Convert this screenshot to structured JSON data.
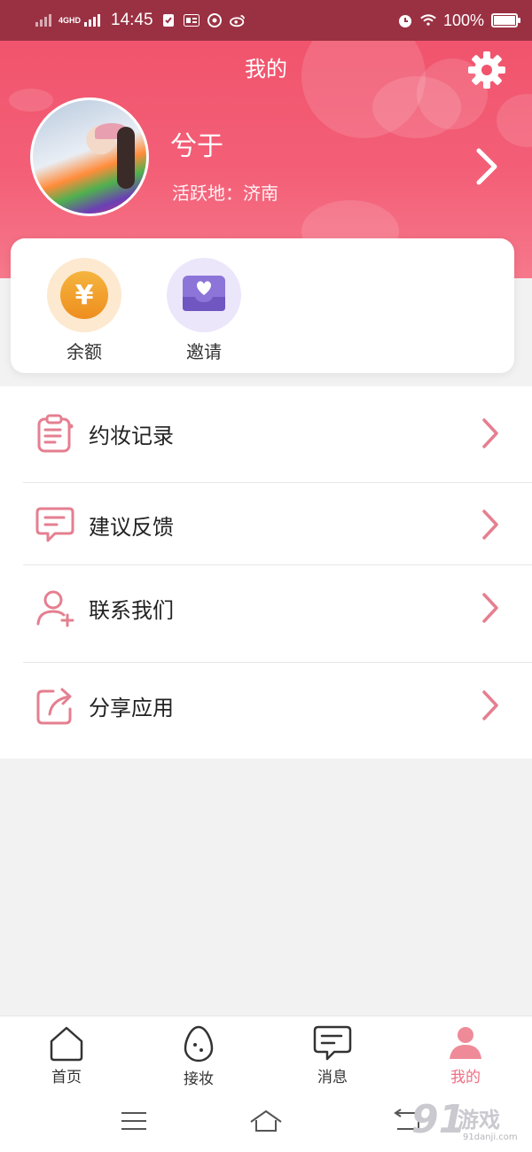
{
  "status_bar": {
    "network": "4GHD",
    "time": "14:45",
    "battery": "100%",
    "battery_level": 1.0
  },
  "header": {
    "title": "我的",
    "user_name": "兮于",
    "location": "活跃地：济南"
  },
  "quick_actions": [
    {
      "label": "余额",
      "icon": "coin-icon"
    },
    {
      "label": "邀请",
      "icon": "invite-heart-icon"
    }
  ],
  "menu": [
    {
      "label": "约妆记录",
      "icon": "clipboard-icon"
    },
    {
      "label": "建议反馈",
      "icon": "feedback-icon"
    },
    {
      "label": "联系我们",
      "icon": "contact-person-icon"
    },
    {
      "label": "分享应用",
      "icon": "share-icon"
    }
  ],
  "bottom_nav": [
    {
      "label": "首页",
      "icon": "home-icon",
      "active": false
    },
    {
      "label": "接妆",
      "icon": "egg-icon",
      "active": false
    },
    {
      "label": "消息",
      "icon": "message-icon",
      "active": false
    },
    {
      "label": "我的",
      "icon": "person-icon",
      "active": true
    }
  ],
  "colors": {
    "accent": "#ef6e83",
    "header": "#f1546d",
    "status_bar": "#9a3143"
  },
  "watermark": {
    "number": "91",
    "text": "游戏",
    "site": "91danji.com"
  }
}
